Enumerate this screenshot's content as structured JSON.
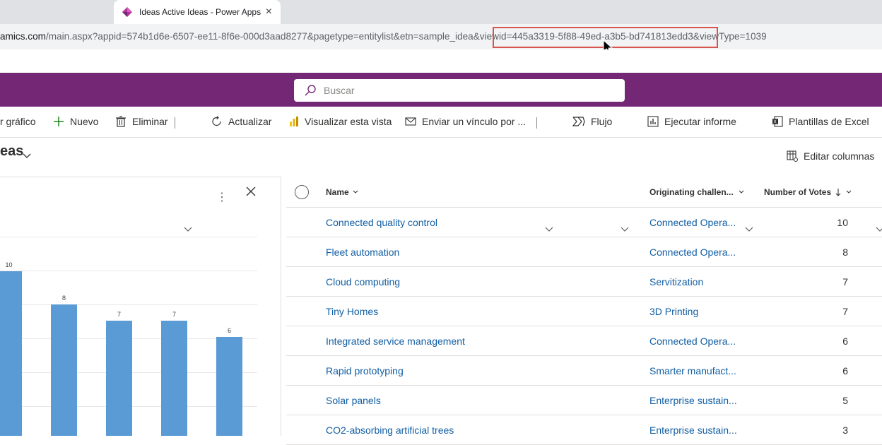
{
  "browser": {
    "tab_title": "Ideas Active Ideas - Power Apps",
    "url_host": "amics.com",
    "url_rest": "/main.aspx?appid=574b1d6e-6507-ee11-8f6e-000d3aad8277&pagetype=entitylist&etn=sample_idea&viewid=445a3319-5f88-49ed-a3b5-bd741813edd3&viewType=1039"
  },
  "search": {
    "placeholder": "Buscar"
  },
  "commands": {
    "chart": "r gráfico",
    "new": "Nuevo",
    "delete": "Eliminar",
    "refresh": "Actualizar",
    "visualize": "Visualizar esta vista",
    "send_link": "Enviar un vínculo por ...",
    "flow": "Flujo",
    "run_report": "Ejecutar informe",
    "excel_templates": "Plantillas de Excel"
  },
  "view": {
    "title": "eas",
    "edit_columns": "Editar columnas"
  },
  "columns": {
    "name": "Name",
    "challenge": "Originating challen...",
    "votes": "Number of Votes"
  },
  "rows": [
    {
      "name": "Connected quality control",
      "challenge": "Connected Opera...",
      "votes": "10"
    },
    {
      "name": "Fleet automation",
      "challenge": "Connected Opera...",
      "votes": "8"
    },
    {
      "name": "Cloud computing",
      "challenge": "Servitization",
      "votes": "7"
    },
    {
      "name": "Tiny Homes",
      "challenge": "3D Printing",
      "votes": "7"
    },
    {
      "name": "Integrated service management",
      "challenge": "Connected Opera...",
      "votes": "6"
    },
    {
      "name": "Rapid prototyping",
      "challenge": "Smarter manufact...",
      "votes": "6"
    },
    {
      "name": "Solar panels",
      "challenge": "Enterprise sustain...",
      "votes": "5"
    },
    {
      "name": "CO2-absorbing artificial trees",
      "challenge": "Enterprise sustain...",
      "votes": "3"
    }
  ],
  "chart_data": {
    "type": "bar",
    "values": [
      10,
      8,
      7,
      7,
      6
    ],
    "labels": [
      "10",
      "8",
      "7",
      "7",
      "6"
    ]
  },
  "colors": {
    "brand": "#742774",
    "bar": "#5b9bd5",
    "link": "#115ea3"
  }
}
